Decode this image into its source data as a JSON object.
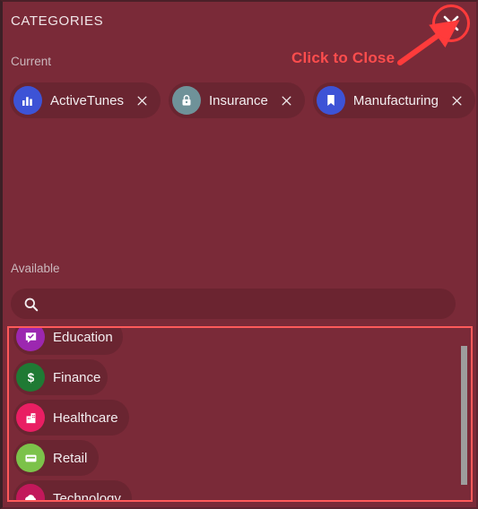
{
  "panel": {
    "title": "CATEGORIES",
    "close_icon": "close-icon"
  },
  "sections": {
    "current_label": "Current",
    "available_label": "Available"
  },
  "current_chips": [
    {
      "label": "ActiveTunes",
      "icon": "bar-chart-icon",
      "color": "#3d53d6",
      "remove_icon": "remove-icon"
    },
    {
      "label": "Insurance",
      "icon": "lock-icon",
      "color": "#6f9299",
      "remove_icon": "remove-icon"
    },
    {
      "label": "Manufacturing",
      "icon": "book-icon",
      "color": "#3d53d6",
      "remove_icon": "remove-icon"
    }
  ],
  "search": {
    "value": "",
    "placeholder": "",
    "icon": "search-icon"
  },
  "available_items": [
    {
      "label": "Education",
      "icon": "chat-check-icon",
      "color": "#9c27b0"
    },
    {
      "label": "Finance",
      "icon": "dollar-icon",
      "color": "#1f7a34"
    },
    {
      "label": "Healthcare",
      "icon": "hospital-icon",
      "color": "#e91e63"
    },
    {
      "label": "Retail",
      "icon": "card-icon",
      "color": "#7cc24a"
    },
    {
      "label": "Technology",
      "icon": "cloud-icon",
      "color": "#c2185b"
    }
  ],
  "annotations": {
    "click_to_close": "Click to Close",
    "highlight_color": "#ff5a5a",
    "annotation_color": "#ff3b3b"
  },
  "scrollbar": {
    "thumb_color": "#9d9d9d"
  },
  "theme": {
    "background": "#7a2a38",
    "chip_background": "#6a2531",
    "text_color": "#f3eef0",
    "label_color": "#cbb8bd"
  }
}
